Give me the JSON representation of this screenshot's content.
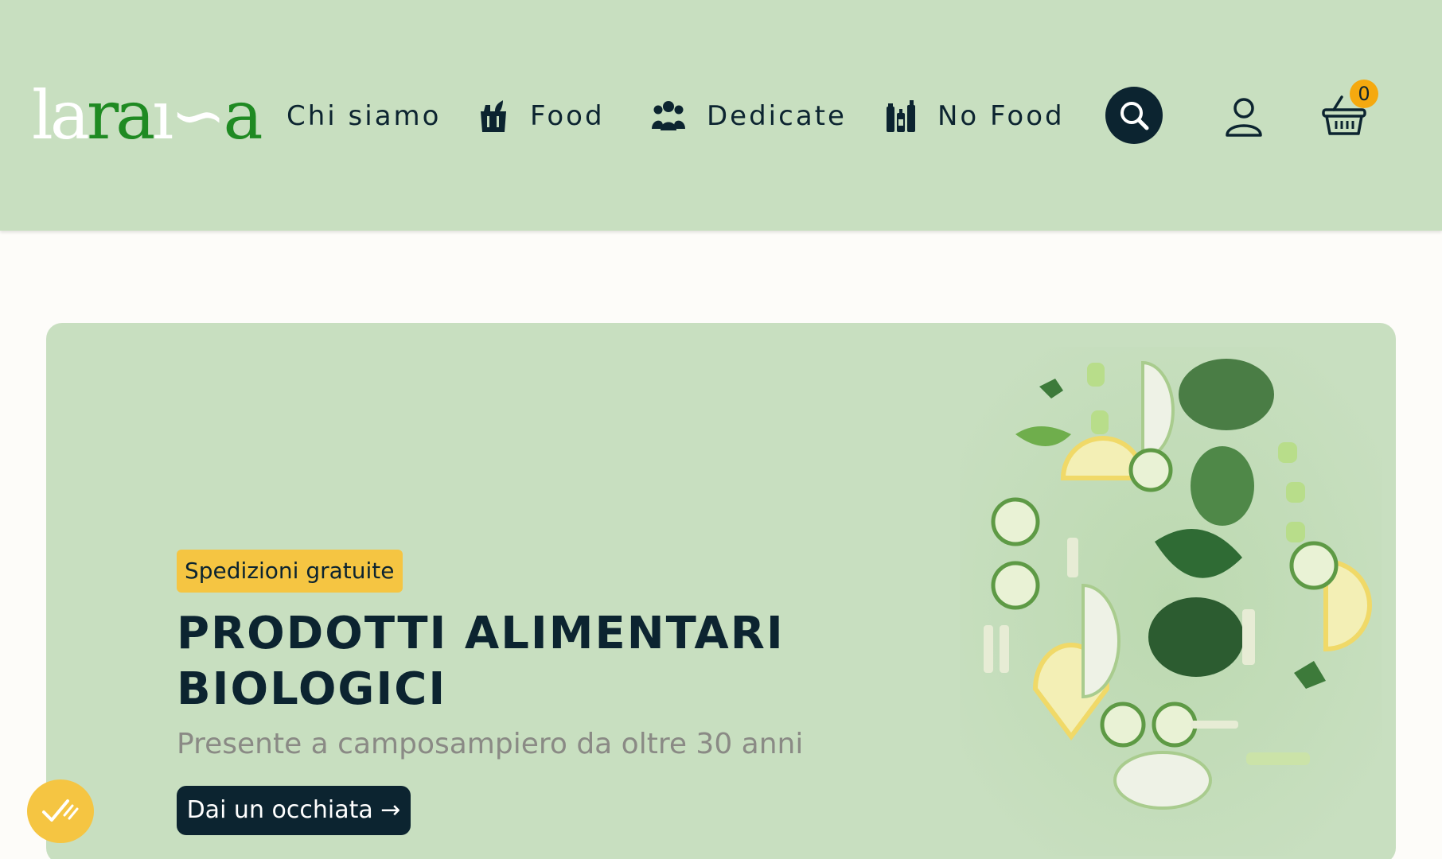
{
  "brand": {
    "logo_text": "laraisa"
  },
  "nav": {
    "items": [
      {
        "label": "Chi siamo",
        "icon": "none"
      },
      {
        "label": "Food",
        "icon": "grocery-bag-icon"
      },
      {
        "label": "Dedicate",
        "icon": "group-people-icon"
      },
      {
        "label": "No Food",
        "icon": "bottles-icon"
      }
    ]
  },
  "header_actions": {
    "search_icon": "search-icon",
    "user_icon": "user-icon",
    "cart_icon": "basket-icon",
    "cart_count": "0"
  },
  "hero": {
    "badge": "Spedizioni gratuite",
    "title": "PRODOTTI ALIMENTARI BIOLOGICI",
    "subtitle": "Presente a camposampiero da oltre 30 anni",
    "cta_label": "Dai un occhiata →"
  },
  "colors": {
    "header_bg": "#c8dfc0",
    "hero_bg": "#c8dfc0",
    "page_bg": "#fdfcf9",
    "dark_navy": "#0c2430",
    "badge_yellow": "#f5c542",
    "cart_badge_orange": "#f5a90f",
    "logo_green": "#1f8a22",
    "subtitle_gray": "#8a8a85"
  }
}
